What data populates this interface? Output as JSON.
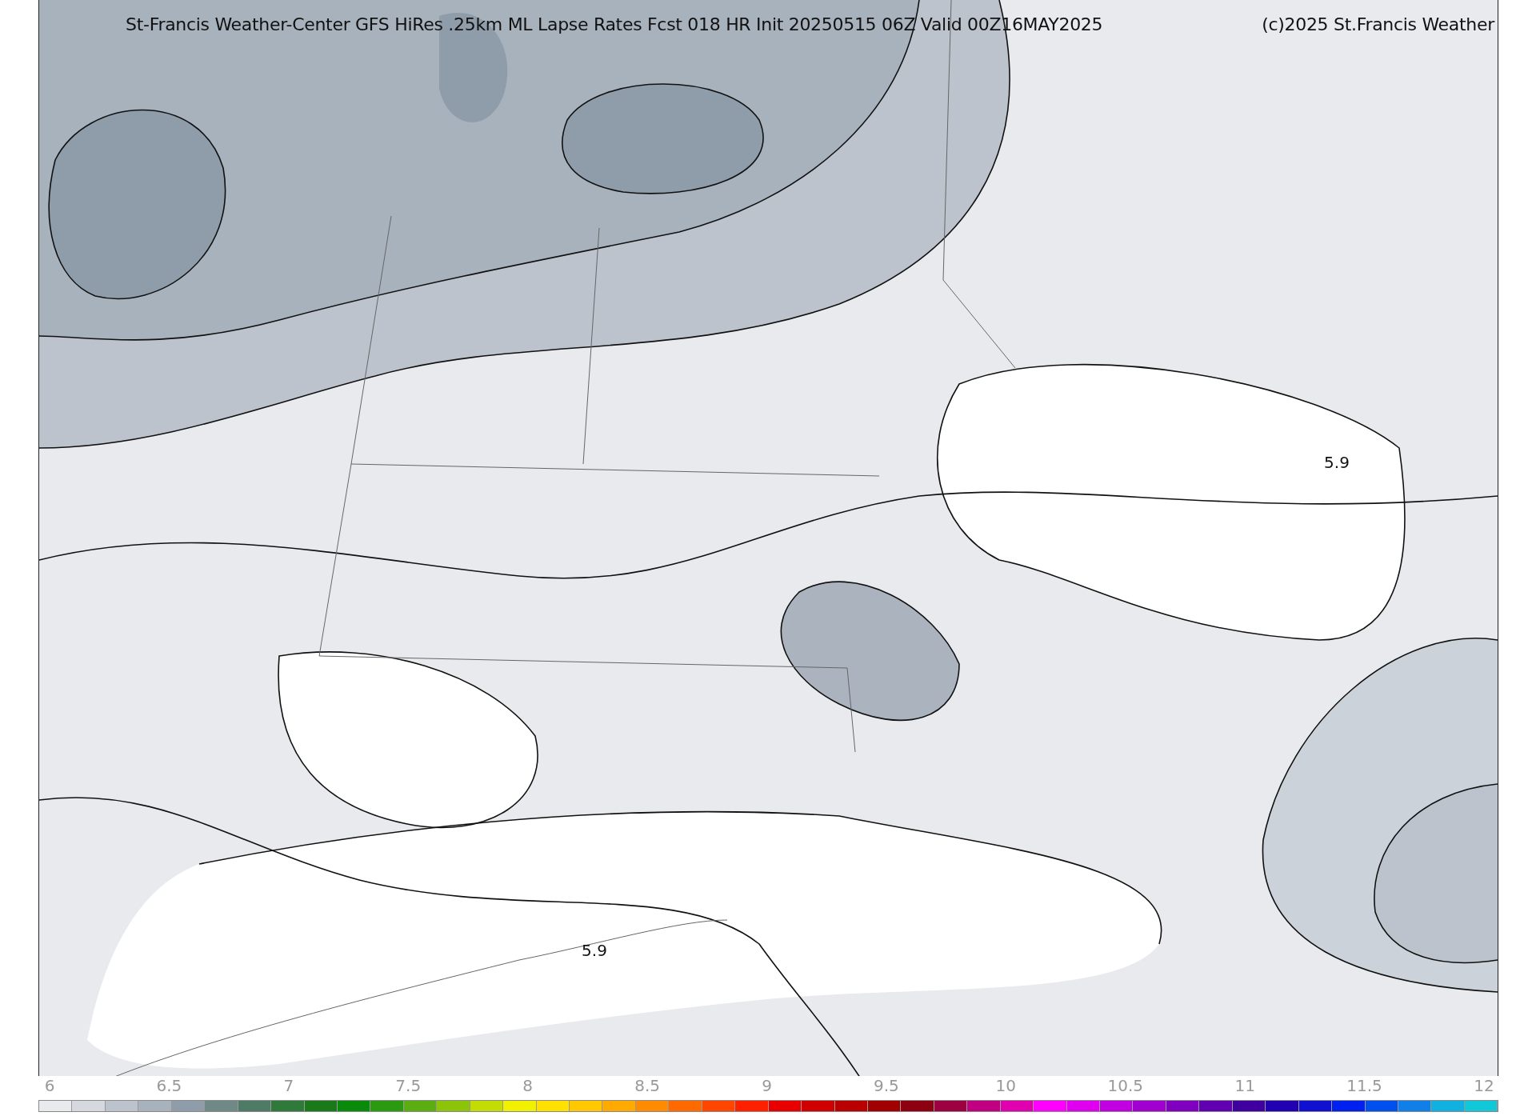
{
  "title": {
    "text": "St-Francis Weather-Center GFS HiRes .25km ML Lapse Rates  Fcst 018 HR Init 20250515 06Z  Valid 00Z16MAY2025",
    "credit": "(c)2025 St.Francis Weather"
  },
  "map": {
    "contour_labels": [
      "5.9",
      "5.9"
    ]
  },
  "colorbar": {
    "ticks": [
      "6",
      "6.5",
      "7",
      "7.5",
      "8",
      "8.5",
      "9",
      "9.5",
      "10",
      "10.5",
      "11",
      "11.5",
      "12"
    ]
  }
}
